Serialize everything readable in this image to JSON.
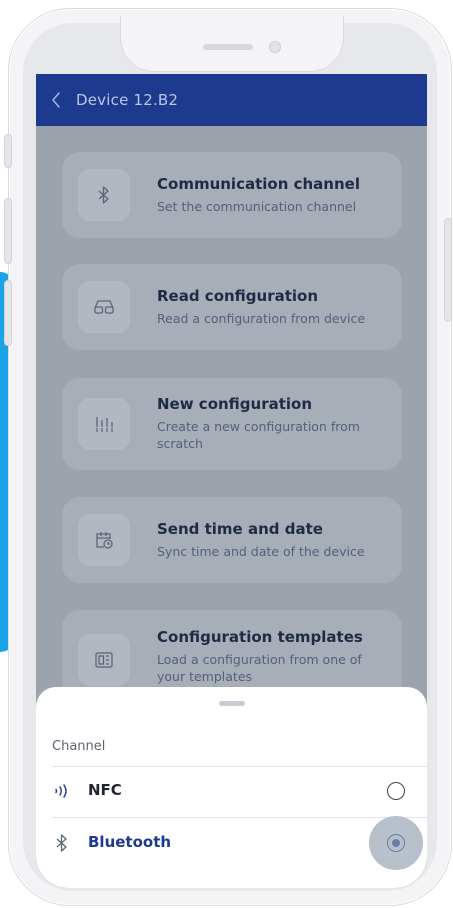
{
  "app_bar": {
    "back_icon": "chevron-left-icon",
    "title": "Device 12.B2"
  },
  "menu": [
    {
      "icon": "bluetooth-icon",
      "title": "Communication channel",
      "subtitle": "Set the communication channel"
    },
    {
      "icon": "glasses-icon",
      "title": "Read configuration",
      "subtitle": "Read a configuration from device"
    },
    {
      "icon": "equalizer-icon",
      "title": "New configuration",
      "subtitle": "Create a new configuration from scratch"
    },
    {
      "icon": "calendar-clock-icon",
      "title": "Send time and date",
      "subtitle": "Sync time and date of the device"
    },
    {
      "icon": "template-icon",
      "title": "Configuration templates",
      "subtitle": "Load a configuration from one of your templates"
    }
  ],
  "sheet": {
    "label": "Channel",
    "options": [
      {
        "icon": "nfc-icon",
        "label": "NFC",
        "selected": false
      },
      {
        "icon": "bluetooth-icon",
        "label": "Bluetooth",
        "selected": true
      }
    ]
  },
  "colors": {
    "app_bar": "#1e3a8f",
    "accent_stripe": "#1aa3e6",
    "selected_text": "#1e3a8f",
    "scrim": "#9ca3ad"
  }
}
